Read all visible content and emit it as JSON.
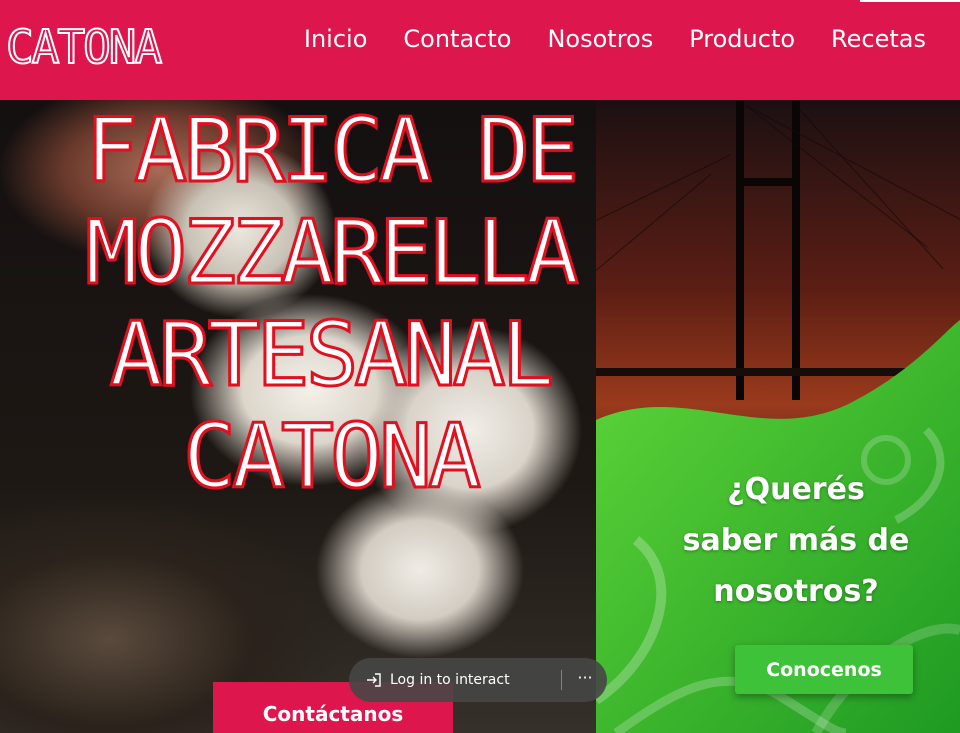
{
  "header": {
    "logo": "CATONA",
    "nav": [
      "Inicio",
      "Contacto",
      "Nosotros",
      "Producto",
      "Recetas"
    ]
  },
  "hero": {
    "title_lines": [
      "FABRICA DE",
      "MOZZARELLA",
      "ARTESANAL",
      "CATONA"
    ],
    "contact_button": "Contáctanos"
  },
  "side": {
    "question_lines": [
      "¿Querés",
      "saber más de",
      "nosotros?"
    ],
    "cta_button": "Conocenos"
  },
  "overlay": {
    "login_label": "Log in to interact",
    "more_label": "···"
  },
  "colors": {
    "brand": "#dd174d",
    "green": "#3ec23a",
    "title_stroke": "#e01020"
  }
}
